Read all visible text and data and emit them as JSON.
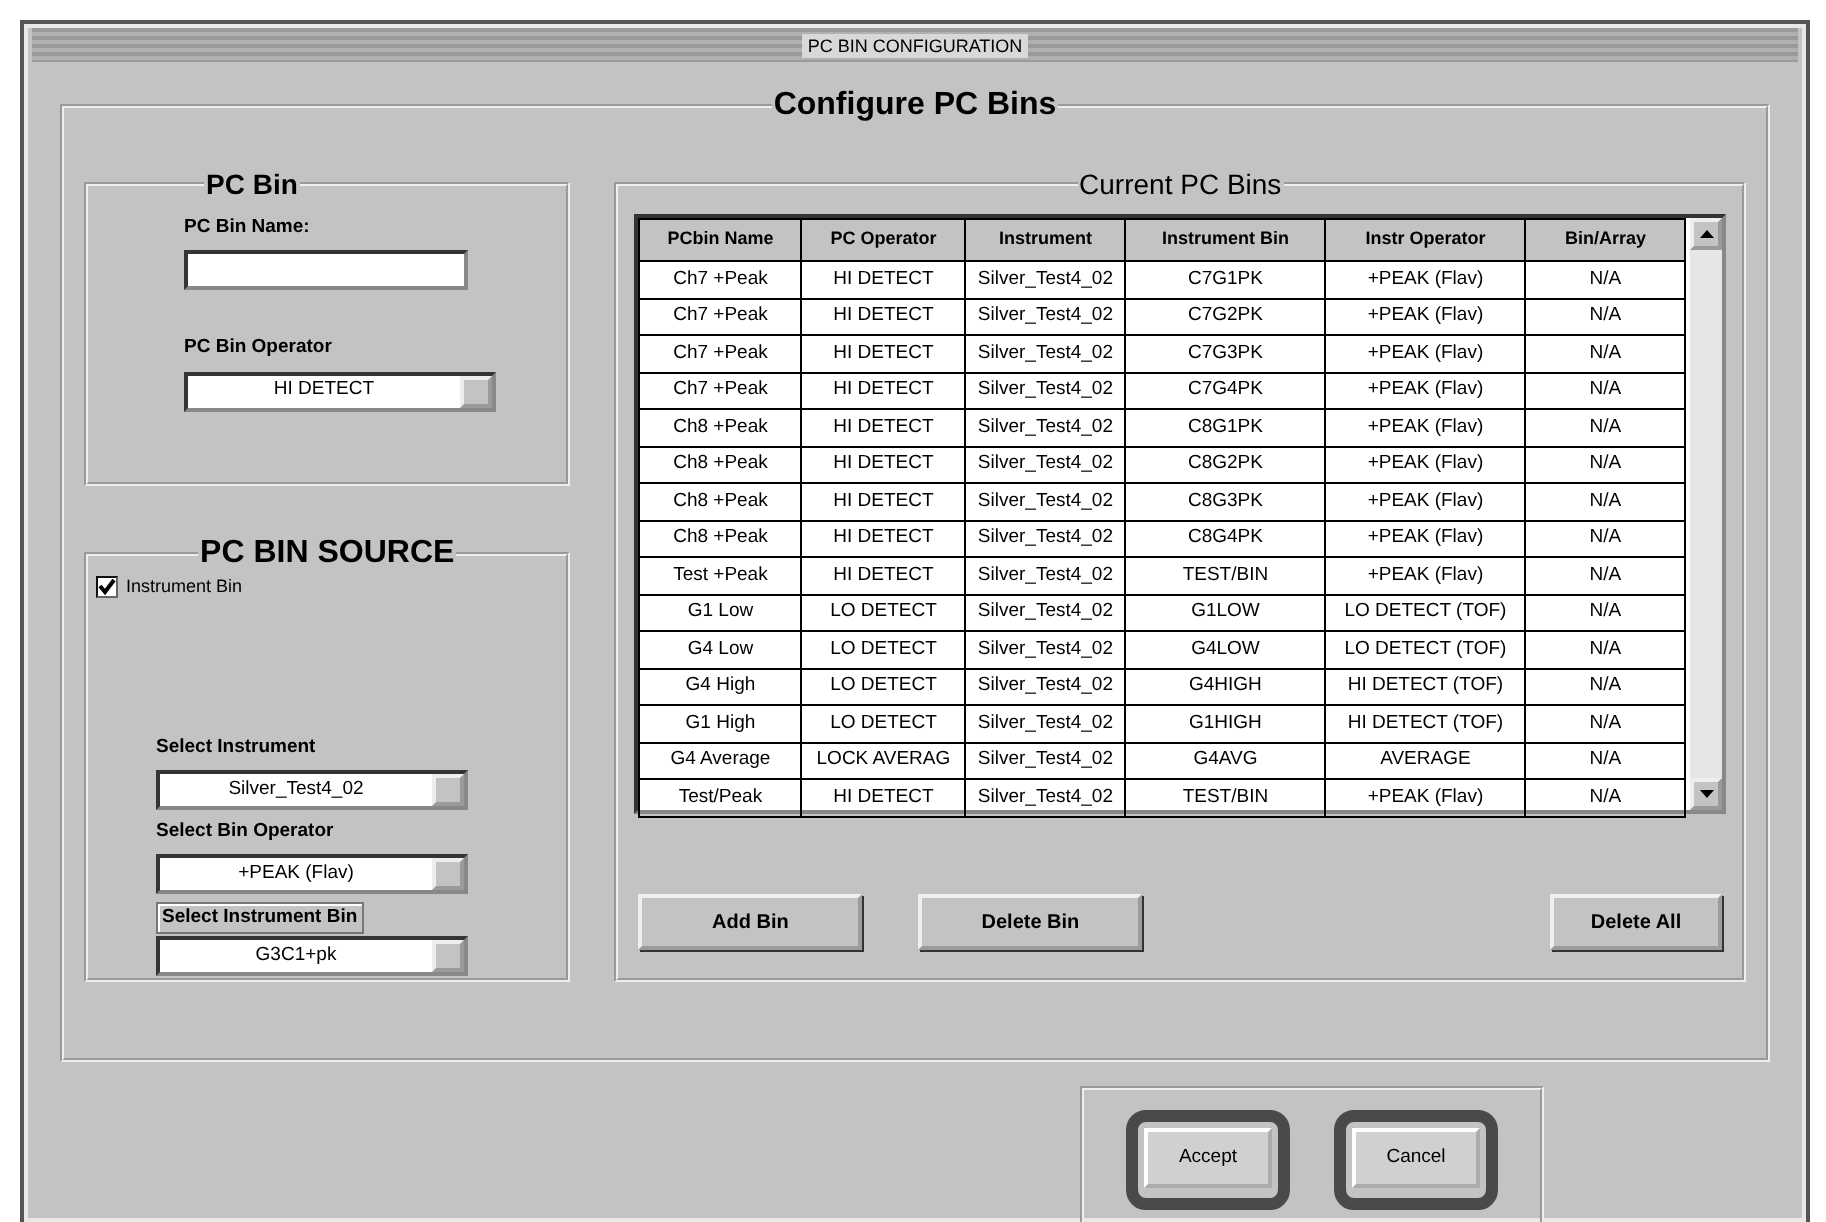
{
  "window": {
    "title": "PC BIN CONFIGURATION"
  },
  "main_group": {
    "title": "Configure PC Bins"
  },
  "pc_bin": {
    "title": "PC Bin",
    "name_label": "PC Bin Name:",
    "operator_label": "PC Bin Operator",
    "operator_value": "HI DETECT"
  },
  "source": {
    "title": "PC BIN SOURCE",
    "instrument_bin": {
      "label": "Instrument Bin",
      "checked": true
    },
    "fields": [
      {
        "label": "Select Instrument",
        "value": "Silver_Test4_02",
        "kind": "plain"
      },
      {
        "label": "Select Bin Operator",
        "value": "+PEAK (Flav)",
        "kind": "plain"
      },
      {
        "label": "Select Instrument Bin",
        "value": "G3C1+pk",
        "kind": "boxed"
      }
    ]
  },
  "current_bins": {
    "title": "Current PC Bins",
    "columns": [
      "PCbin Name",
      "PC Operator",
      "Instrument",
      "Instrument Bin",
      "Instr Operator",
      "Bin/Array"
    ],
    "rows": [
      [
        "Ch7 +Peak",
        "HI DETECT",
        "Silver_Test4_02",
        "C7G1PK",
        "+PEAK (Flav)",
        "N/A"
      ],
      [
        "Ch7 +Peak",
        "HI DETECT",
        "Silver_Test4_02",
        "C7G2PK",
        "+PEAK (Flav)",
        "N/A"
      ],
      [
        "Ch7 +Peak",
        "HI DETECT",
        "Silver_Test4_02",
        "C7G3PK",
        "+PEAK (Flav)",
        "N/A"
      ],
      [
        "Ch7 +Peak",
        "HI DETECT",
        "Silver_Test4_02",
        "C7G4PK",
        "+PEAK (Flav)",
        "N/A"
      ],
      [
        "Ch8 +Peak",
        "HI DETECT",
        "Silver_Test4_02",
        "C8G1PK",
        "+PEAK (Flav)",
        "N/A"
      ],
      [
        "Ch8 +Peak",
        "HI DETECT",
        "Silver_Test4_02",
        "C8G2PK",
        "+PEAK (Flav)",
        "N/A"
      ],
      [
        "Ch8 +Peak",
        "HI DETECT",
        "Silver_Test4_02",
        "C8G3PK",
        "+PEAK (Flav)",
        "N/A"
      ],
      [
        "Ch8 +Peak",
        "HI DETECT",
        "Silver_Test4_02",
        "C8G4PK",
        "+PEAK (Flav)",
        "N/A"
      ],
      [
        "Test +Peak",
        "HI DETECT",
        "Silver_Test4_02",
        "TEST/BIN",
        "+PEAK (Flav)",
        "N/A"
      ],
      [
        "G1 Low",
        "LO DETECT",
        "Silver_Test4_02",
        "G1LOW",
        "LO DETECT (TOF)",
        "N/A"
      ],
      [
        "G4 Low",
        "LO DETECT",
        "Silver_Test4_02",
        "G4LOW",
        "LO DETECT (TOF)",
        "N/A"
      ],
      [
        "G4 High",
        "LO DETECT",
        "Silver_Test4_02",
        "G4HIGH",
        "HI DETECT (TOF)",
        "N/A"
      ],
      [
        "G1 High",
        "LO DETECT",
        "Silver_Test4_02",
        "G1HIGH",
        "HI DETECT (TOF)",
        "N/A"
      ],
      [
        "G4 Average",
        "LOCK AVERAG",
        "Silver_Test4_02",
        "G4AVG",
        "AVERAGE",
        "N/A"
      ],
      [
        "Test/Peak",
        "HI DETECT",
        "Silver_Test4_02",
        "TEST/BIN",
        "+PEAK (Flav)",
        "N/A"
      ]
    ]
  },
  "buttons": [
    "Add Bin",
    "Delete Bin",
    "Delete All"
  ],
  "dialog_buttons": [
    "Accept",
    "Cancel"
  ]
}
